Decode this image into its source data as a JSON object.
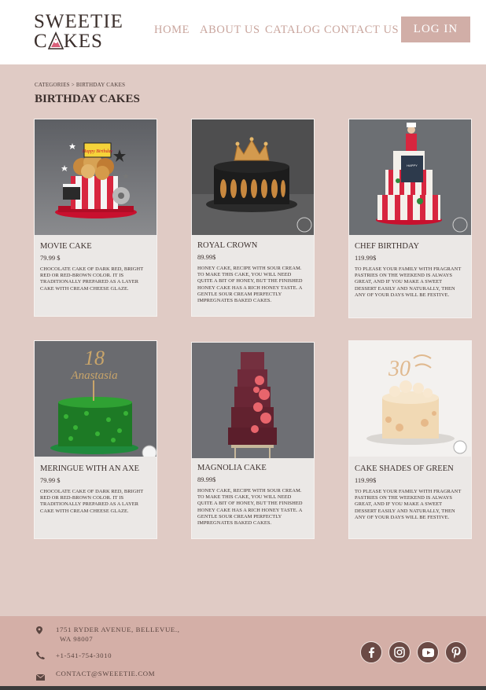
{
  "brand": {
    "logo_line1": "SWEETIE",
    "logo_line2a": "C",
    "logo_line2b": "KES"
  },
  "nav": {
    "home": "HOME",
    "about": "ABOUT US",
    "catalog": "CATALOG",
    "contact": "CONTACT US"
  },
  "login_label": "LOG IN",
  "breadcrumb": "CATEGORIES > BIRTHDAY CAKES",
  "page_title": "BIRTHDAY CAKES",
  "products": [
    {
      "name": "MOVIE CAKE",
      "price": "79.99 $",
      "description": "CHOCOLATE CAKE OF DARK RED, BRIGHT RED OR RED-BROWN COLOR. IT IS TRADITIONALLY PREPARED AS A LAYER CAKE WITH CREAM CHEESE GLAZE.",
      "topper_text": "Happy Birthday"
    },
    {
      "name": "ROYAL CROWN",
      "price": "89.99$",
      "description": "HONEY CAKE, RECIPE WITH SOUR CREAM. TO MAKE THIS CAKE, YOU WILL NEED QUITE A BIT OF HONEY, BUT THE FINISHED HONEY CAKE HAS A RICH HONEY TASTE. A GENTLE SOUR CREAM PERFECTLY IMPREGNATES BAKED CAKES."
    },
    {
      "name": "CHEF BIRTHDAY",
      "price": "119.99$",
      "description": "TO PLEASE YOUR FAMILY WITH FRAGRANT PASTRIES ON THE WEEKEND IS ALWAYS GREAT, AND IF YOU MAKE A SWEET DESSERT EASILY AND NATURALLY, THEN ANY OF YOUR DAYS WILL BE FESTIVE."
    },
    {
      "name": "MERINGUE WITH AN AXE",
      "price": "79.99 $",
      "description": "CHOCOLATE CAKE OF DARK RED, BRIGHT RED OR RED-BROWN COLOR. IT IS TRADITIONALLY PREPARED AS A LAYER CAKE WITH CREAM CHEESE GLAZE.",
      "topper_number": "18",
      "topper_name": "Anastasia"
    },
    {
      "name": "MAGNOLIA CAKE",
      "price": "89.99$",
      "description": "HONEY CAKE, RECIPE WITH SOUR CREAM. TO MAKE THIS CAKE, YOU WILL NEED QUITE A BIT OF HONEY, BUT THE FINISHED HONEY CAKE HAS A RICH HONEY TASTE. A GENTLE SOUR CREAM PERFECTLY IMPREGNATES BAKED CAKES."
    },
    {
      "name": "CAKE SHADES OF GREEN",
      "price": "119.99$",
      "description": "TO PLEASE YOUR FAMILY WITH FRAGRANT PASTRIES ON THE WEEKEND IS ALWAYS GREAT, AND IF YOU MAKE A SWEET DESSERT EASILY AND NATURALLY, THEN ANY OF YOUR DAYS WILL BE FESTIVE.",
      "topper_number": "30"
    }
  ],
  "footer": {
    "address_line1": "1751 RYDER AVENUE, BELLEVUE.,",
    "address_line2": "WA 98007",
    "phone": "+1-541-754-3010",
    "email": "CONTACT@SWEEETIE.COM"
  },
  "social": [
    "facebook-icon",
    "instagram-icon",
    "youtube-icon",
    "pinterest-icon"
  ],
  "colors": {
    "background": "#e0cbc5",
    "accent": "#d1aea7",
    "nav_text": "#c9a59d",
    "footer": "#d4afa7",
    "social_button": "#6b4a45"
  }
}
